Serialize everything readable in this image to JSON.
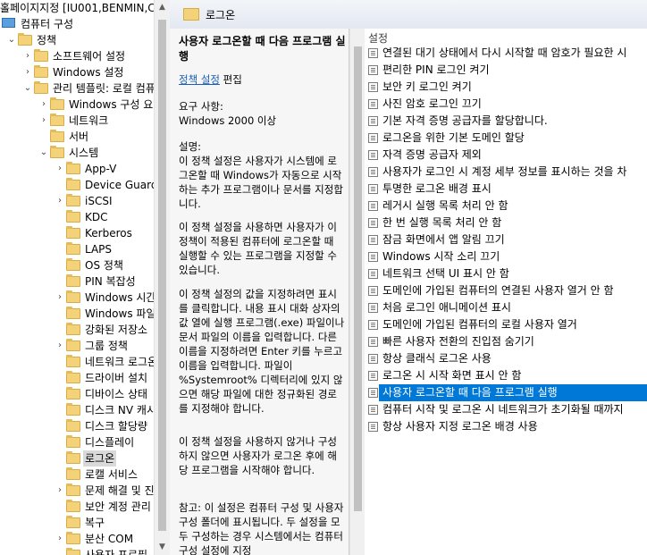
{
  "window_title_fragment": "홀페이지지정 [IU001,BENMIN,C",
  "tree": {
    "items": [
      {
        "label": "컴퓨터 구성",
        "icon": "computer-icon",
        "indent": 0,
        "chev": "collapse",
        "selected": false
      },
      {
        "label": "정책",
        "icon": "folder-icon",
        "indent": 1,
        "chev": "collapse",
        "selected": false
      },
      {
        "label": "소프트웨어 설정",
        "icon": "folder-icon",
        "indent": 2,
        "chev": "expand",
        "selected": false
      },
      {
        "label": "Windows 설정",
        "icon": "folder-icon",
        "indent": 2,
        "chev": "expand",
        "selected": false
      },
      {
        "label": "관리 템플릿: 로컬 컴퓨",
        "icon": "folder-icon",
        "indent": 2,
        "chev": "collapse",
        "selected": false
      },
      {
        "label": "Windows 구성 요소",
        "icon": "folder-icon",
        "indent": 3,
        "chev": "expand",
        "selected": false
      },
      {
        "label": "네트워크",
        "icon": "folder-icon",
        "indent": 3,
        "chev": "expand",
        "selected": false
      },
      {
        "label": "서버",
        "icon": "folder-icon",
        "indent": 3,
        "chev": "",
        "selected": false
      },
      {
        "label": "시스템",
        "icon": "folder-icon",
        "indent": 3,
        "chev": "collapse",
        "selected": false
      },
      {
        "label": "App-V",
        "icon": "folder-icon",
        "indent": 4,
        "chev": "expand",
        "selected": false
      },
      {
        "label": "Device Guard",
        "icon": "folder-icon",
        "indent": 4,
        "chev": "",
        "selected": false
      },
      {
        "label": "iSCSI",
        "icon": "folder-icon",
        "indent": 4,
        "chev": "expand",
        "selected": false
      },
      {
        "label": "KDC",
        "icon": "folder-icon",
        "indent": 4,
        "chev": "",
        "selected": false
      },
      {
        "label": "Kerberos",
        "icon": "folder-icon",
        "indent": 4,
        "chev": "",
        "selected": false
      },
      {
        "label": "LAPS",
        "icon": "folder-icon",
        "indent": 4,
        "chev": "",
        "selected": false
      },
      {
        "label": "OS 정책",
        "icon": "folder-icon",
        "indent": 4,
        "chev": "",
        "selected": false
      },
      {
        "label": "PIN 복잡성",
        "icon": "folder-icon",
        "indent": 4,
        "chev": "",
        "selected": false
      },
      {
        "label": "Windows 시간",
        "icon": "folder-icon",
        "indent": 4,
        "chev": "expand",
        "selected": false
      },
      {
        "label": "Windows 파일",
        "icon": "folder-icon",
        "indent": 4,
        "chev": "",
        "selected": false
      },
      {
        "label": "강화된 저장소",
        "icon": "folder-icon",
        "indent": 4,
        "chev": "",
        "selected": false
      },
      {
        "label": "그룹 정책",
        "icon": "folder-icon",
        "indent": 4,
        "chev": "expand",
        "selected": false
      },
      {
        "label": "네트워크 로그온",
        "icon": "folder-icon",
        "indent": 4,
        "chev": "",
        "selected": false
      },
      {
        "label": "드라이버 설치",
        "icon": "folder-icon",
        "indent": 4,
        "chev": "",
        "selected": false
      },
      {
        "label": "디바이스 상태",
        "icon": "folder-icon",
        "indent": 4,
        "chev": "",
        "selected": false
      },
      {
        "label": "디스크 NV 캐시",
        "icon": "folder-icon",
        "indent": 4,
        "chev": "",
        "selected": false
      },
      {
        "label": "디스크 할당량",
        "icon": "folder-icon",
        "indent": 4,
        "chev": "",
        "selected": false
      },
      {
        "label": "디스플레이",
        "icon": "folder-icon",
        "indent": 4,
        "chev": "",
        "selected": false
      },
      {
        "label": "로그온",
        "icon": "folder-icon",
        "indent": 4,
        "chev": "",
        "selected": true
      },
      {
        "label": "로캘 서비스",
        "icon": "folder-icon",
        "indent": 4,
        "chev": "",
        "selected": false
      },
      {
        "label": "문제 해결 및 진",
        "icon": "folder-icon",
        "indent": 4,
        "chev": "expand",
        "selected": false
      },
      {
        "label": "보안 계정 관리",
        "icon": "folder-icon",
        "indent": 4,
        "chev": "",
        "selected": false
      },
      {
        "label": "복구",
        "icon": "folder-icon",
        "indent": 4,
        "chev": "",
        "selected": false
      },
      {
        "label": "분산 COM",
        "icon": "folder-icon",
        "indent": 4,
        "chev": "expand",
        "selected": false
      },
      {
        "label": "사용자 프로필",
        "icon": "folder-icon",
        "indent": 4,
        "chev": "",
        "selected": false
      }
    ]
  },
  "header": {
    "title": "로그온"
  },
  "description": {
    "title": "사용자 로그온할 때 다음 프로그램 실행",
    "edit_link": "정책 설정",
    "edit_suffix": " 편집",
    "requirement_label": "요구 사항:",
    "requirement_value": "Windows 2000 이상",
    "desc_label": "설명:",
    "para1": "이 정책 설정은 사용자가 시스템에 로그온할 때 Windows가 자동으로 시작하는 추가 프로그램이나 문서를 지정합니다.",
    "para2": "이 정책 설정을 사용하면 사용자가 이 정책이 적용된 컴퓨터에 로그온할 때 실행할 수 있는 프로그램을 지정할 수 있습니다.",
    "para3": "이 정책 설정의 값을 지정하려면 표시를 클릭합니다. 내용 표시 대화 상자의 값 열에 실행 프로그램(.exe) 파일이나 문서 파일의 이름을 입력합니다. 다른 이름을 지정하려면 Enter 키를 누르고 이름을 입력합니다. 파일이 %Systemroot% 디렉터리에 있지 않으면 해당 파일에 대한 정규화된 경로를 지정해야 합니다.",
    "para4": "이 정책 설정을 사용하지 않거나 구성하지 않으면 사용자가 로그온 후에 해당 프로그램을 시작해야 합니다.",
    "para5": "참고: 이 설정은 컴퓨터 구성 및 사용자 구성 폴더에 표시됩니다. 두 설정을 모두 구성하는 경우 시스템에서는 컴퓨터 구성 설정에 지정"
  },
  "settings": {
    "column_header": "설정",
    "items": [
      {
        "label": "연결된 대기 상태에서 다시 시작할 때 암호가 필요한 시",
        "selected": false
      },
      {
        "label": "편리한 PIN 로그인 켜기",
        "selected": false
      },
      {
        "label": "보안 키 로그인 켜기",
        "selected": false
      },
      {
        "label": "사진 암호 로그인 끄기",
        "selected": false
      },
      {
        "label": "기본 자격 증명 공급자를 할당합니다.",
        "selected": false
      },
      {
        "label": "로그온을 위한 기본 도메인 할당",
        "selected": false
      },
      {
        "label": "자격 증명 공급자 제외",
        "selected": false
      },
      {
        "label": "사용자가 로그인 시 계정 세부 정보를 표시하는 것을 차",
        "selected": false
      },
      {
        "label": "투명한 로그온 배경 표시",
        "selected": false
      },
      {
        "label": "레거시 실행 목록 처리 안 함",
        "selected": false
      },
      {
        "label": "한 번 실행 목록 처리 안 함",
        "selected": false
      },
      {
        "label": "잠금 화면에서 앱 알림 끄기",
        "selected": false
      },
      {
        "label": "Windows 시작 소리 끄기",
        "selected": false
      },
      {
        "label": "네트워크 선택 UI 표시 안 함",
        "selected": false
      },
      {
        "label": "도메인에 가입된 컴퓨터의 연결된 사용자 열거 안 함",
        "selected": false
      },
      {
        "label": "처음 로그인 애니메이션 표시",
        "selected": false
      },
      {
        "label": "도메인에 가입된 컴퓨터의 로컬 사용자 열거",
        "selected": false
      },
      {
        "label": "빠른 사용자 전환의 진입점 숨기기",
        "selected": false
      },
      {
        "label": "항상 클래식 로그온 사용",
        "selected": false
      },
      {
        "label": "로그온 시 시작 화면 표시 안 함",
        "selected": false
      },
      {
        "label": "사용자 로그온할 때 다음 프로그램 실행",
        "selected": true
      },
      {
        "label": "컴퓨터 시작 및 로그온 시 네트워크가 초기화될 때까지",
        "selected": false
      },
      {
        "label": "항상 사용자 지정 로그온 배경 사용",
        "selected": false
      }
    ]
  }
}
